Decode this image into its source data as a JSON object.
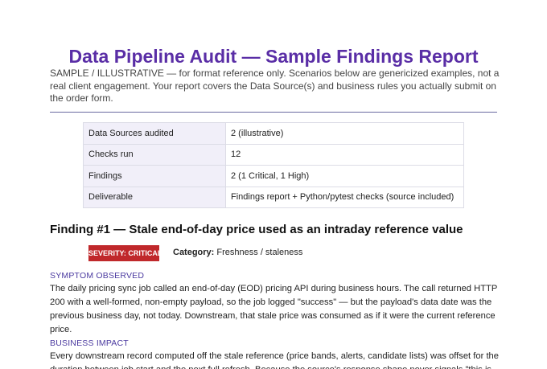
{
  "title": "Data Pipeline Audit — Sample Findings Report",
  "intro": "SAMPLE / ILLUSTRATIVE — for format reference only. Scenarios below are genericized examples, not a real client engagement. Your report covers the Data Source(s) and business rules you actually submit on the order form.",
  "summary": [
    {
      "label": "Data Sources audited",
      "value": "2 (illustrative)"
    },
    {
      "label": "Checks run",
      "value": "12"
    },
    {
      "label": "Findings",
      "value": "2 (1 Critical, 1 High)"
    },
    {
      "label": "Deliverable",
      "value": "Findings report + Python/pytest checks (source included)"
    }
  ],
  "finding": {
    "title": "Finding #1 — Stale end-of-day price used as an intraday reference value",
    "severity": "SEVERITY: CRITICAL",
    "category_label": "Category:",
    "category_value": "Freshness / staleness",
    "symptom_heading": "SYMPTOM OBSERVED",
    "symptom_text": "The daily pricing sync job called an end-of-day (EOD) pricing API during business hours. The call returned HTTP 200 with a well-formed, non-empty payload, so the job logged \"success\" — but the payload's data date was the previous business day, not today. Downstream, that stale price was consumed as if it were the current reference price.",
    "impact_heading": "BUSINESS IMPACT",
    "impact_text": "Every downstream record computed off the stale reference (price bands, alerts, candidate lists) was offset for the duration between job start and the next full refresh. Because the source's response shape never signals \"this is"
  },
  "colors": {
    "accent": "#5a2ea6",
    "severity": "#c0282b"
  }
}
